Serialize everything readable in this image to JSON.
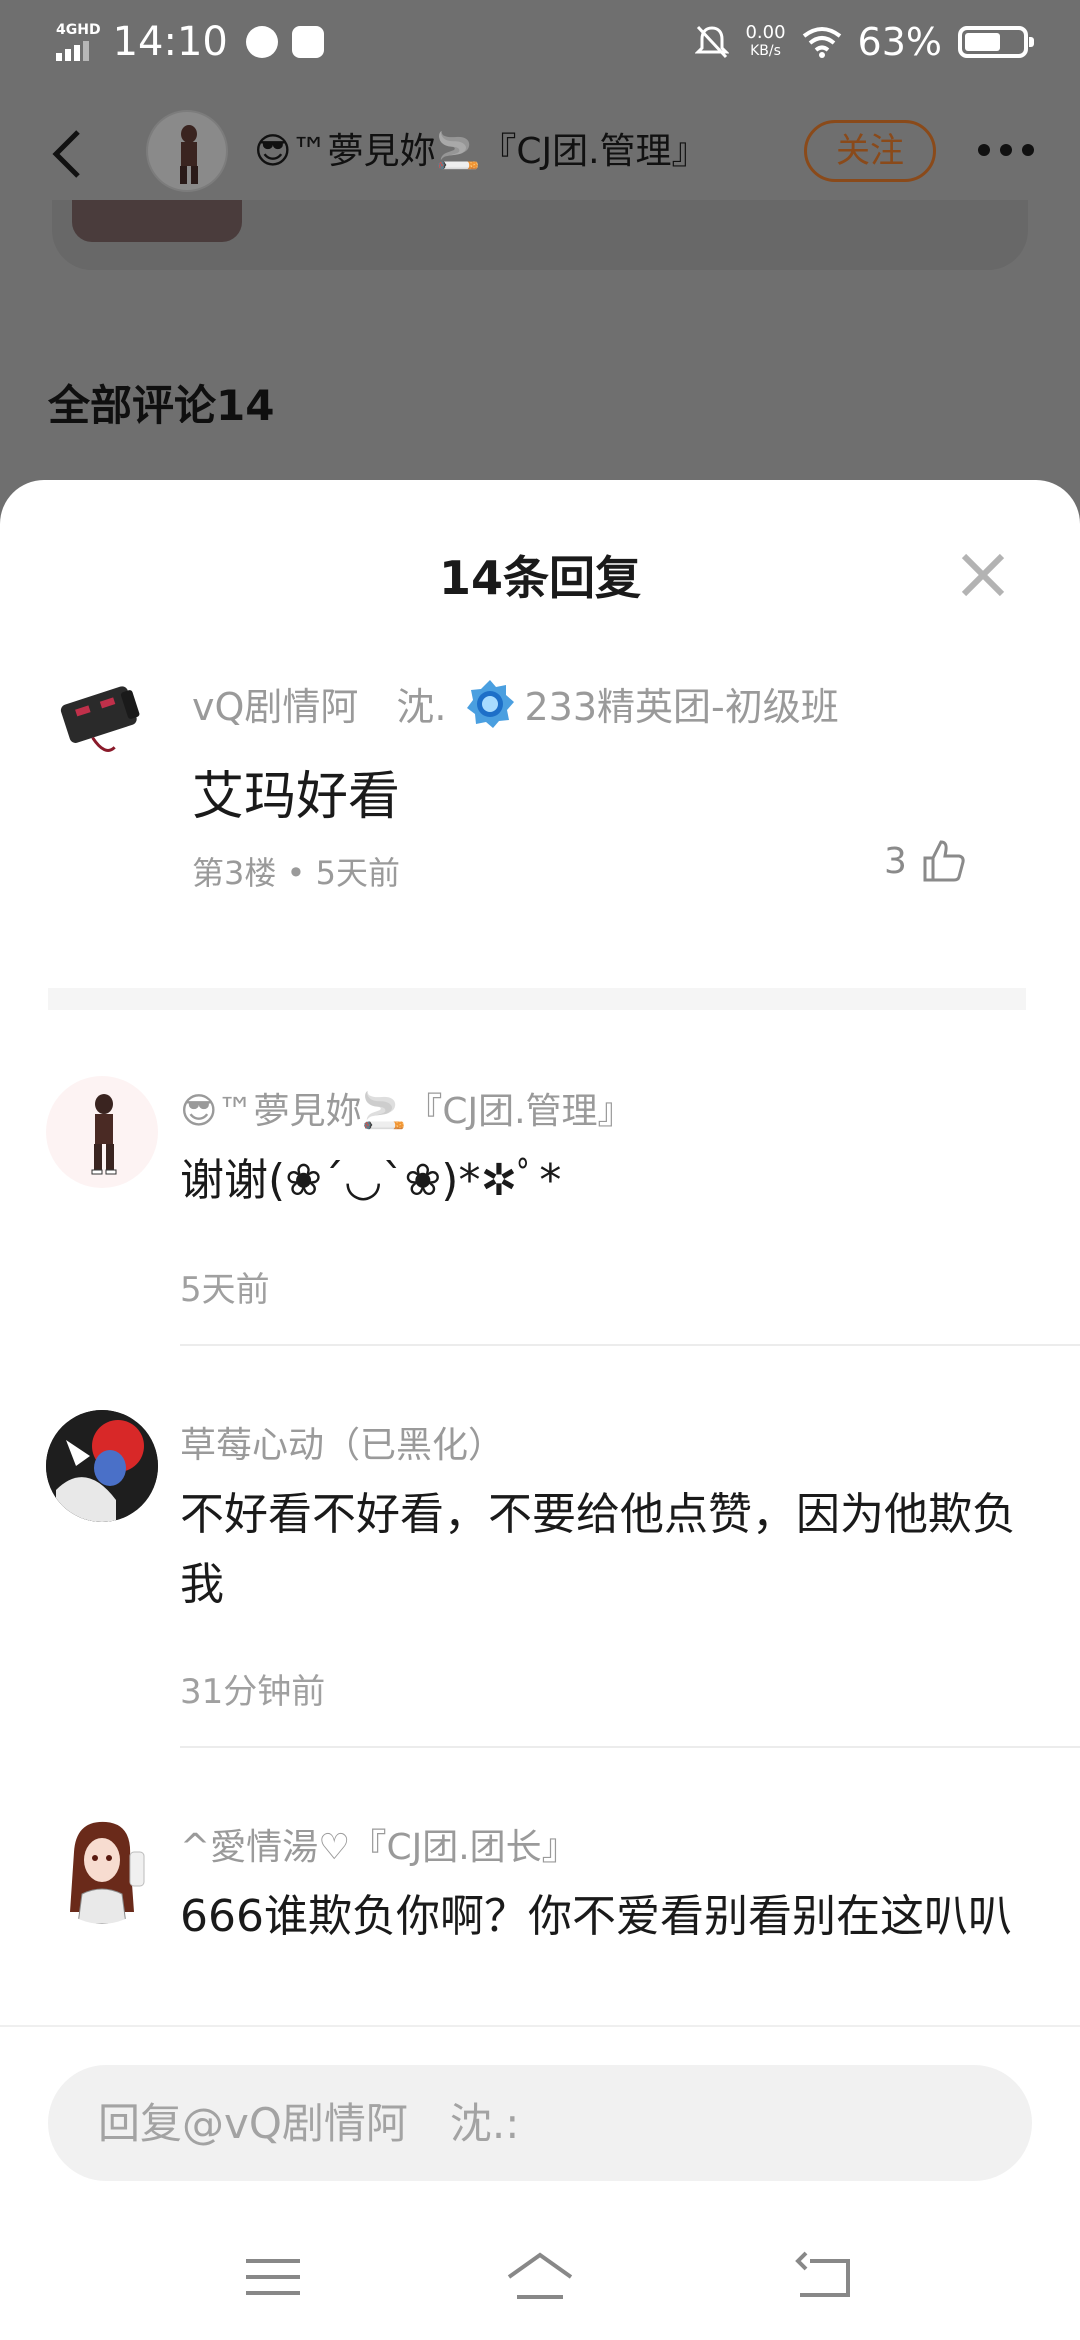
{
  "status_bar": {
    "network": "4GHD",
    "time": "14:10",
    "net_speed_value": "0.00",
    "net_speed_unit": "KB/s",
    "battery_percent": "63%",
    "battery_level": 0.63
  },
  "header": {
    "author_name": "😎™夢見妳🚬『CJ团.管理』",
    "follow_label": "关注"
  },
  "background": {
    "comments_title": "全部评论14"
  },
  "sheet": {
    "title": "14条回复",
    "main_comment": {
      "user": "vQ剧情阿　沈.",
      "badge_label": "233精英团-初级班",
      "text": "艾玛好看",
      "meta": "第3楼 • 5天前",
      "like_count": "3"
    },
    "replies": [
      {
        "user": "😎™夢見妳🚬『CJ团.管理』",
        "text": "谢谢(❀´◡`❀)*✲ﾟ*",
        "time": "5天前"
      },
      {
        "user": "草莓心动（已黑化）",
        "text": "不好看不好看，不要给他点赞，因为他欺负我",
        "time": "31分钟前"
      },
      {
        "user": "^愛情湯♡『CJ团.团长』",
        "text": "666谁欺负你啊？你不爱看别看别在这叭叭",
        "time": ""
      }
    ],
    "input_placeholder": "回复@vQ剧情阿　沈.:"
  },
  "colors": {
    "accent": "#E07A2C",
    "overlay": "#707070"
  }
}
